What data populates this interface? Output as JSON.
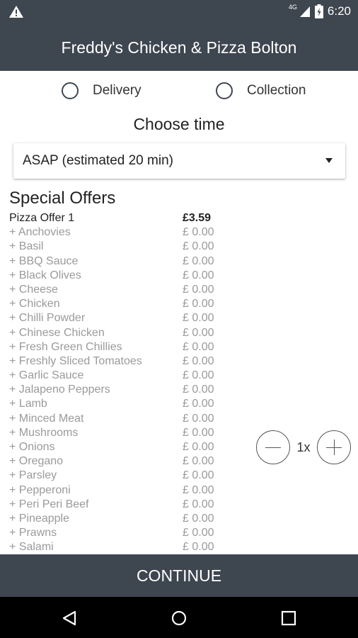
{
  "status_bar": {
    "network": "4G",
    "time": "6:20"
  },
  "app_bar": {
    "title": "Freddy's Chicken & Pizza Bolton"
  },
  "order_method": {
    "delivery_label": "Delivery",
    "collection_label": "Collection"
  },
  "time_picker": {
    "heading": "Choose time",
    "selected": "ASAP (estimated 20 min)"
  },
  "offers": {
    "title": "Special Offers",
    "item": {
      "name": "Pizza Offer 1",
      "price": "£3.59"
    },
    "toppings": [
      {
        "name": "+ Anchovies",
        "price": "£ 0.00"
      },
      {
        "name": "+ Basil",
        "price": "£ 0.00"
      },
      {
        "name": "+ BBQ Sauce",
        "price": "£ 0.00"
      },
      {
        "name": "+ Black Olives",
        "price": "£ 0.00"
      },
      {
        "name": "+ Cheese",
        "price": "£ 0.00"
      },
      {
        "name": "+ Chicken",
        "price": "£ 0.00"
      },
      {
        "name": "+ Chilli Powder",
        "price": "£ 0.00"
      },
      {
        "name": "+ Chinese Chicken",
        "price": "£ 0.00"
      },
      {
        "name": "+ Fresh Green Chillies",
        "price": "£ 0.00"
      },
      {
        "name": "+ Freshly Sliced Tomatoes",
        "price": "£ 0.00"
      },
      {
        "name": "+ Garlic Sauce",
        "price": "£ 0.00"
      },
      {
        "name": "+ Jalapeno Peppers",
        "price": "£ 0.00"
      },
      {
        "name": "+ Lamb",
        "price": "£ 0.00"
      },
      {
        "name": "+ Minced Meat",
        "price": "£ 0.00"
      },
      {
        "name": "+ Mushrooms",
        "price": "£ 0.00"
      },
      {
        "name": "+ Onions",
        "price": "£ 0.00"
      },
      {
        "name": "+ Oregano",
        "price": "£ 0.00"
      },
      {
        "name": "+ Parsley",
        "price": "£ 0.00"
      },
      {
        "name": "+ Pepperoni",
        "price": "£ 0.00"
      },
      {
        "name": "+ Peri Peri Beef",
        "price": "£ 0.00"
      },
      {
        "name": "+ Pineapple",
        "price": "£ 0.00"
      },
      {
        "name": "+ Prawns",
        "price": "£ 0.00"
      },
      {
        "name": "+ Salami",
        "price": "£ 0.00"
      }
    ]
  },
  "quantity": {
    "value": "1x"
  },
  "continue_button": {
    "label": "CONTINUE"
  }
}
